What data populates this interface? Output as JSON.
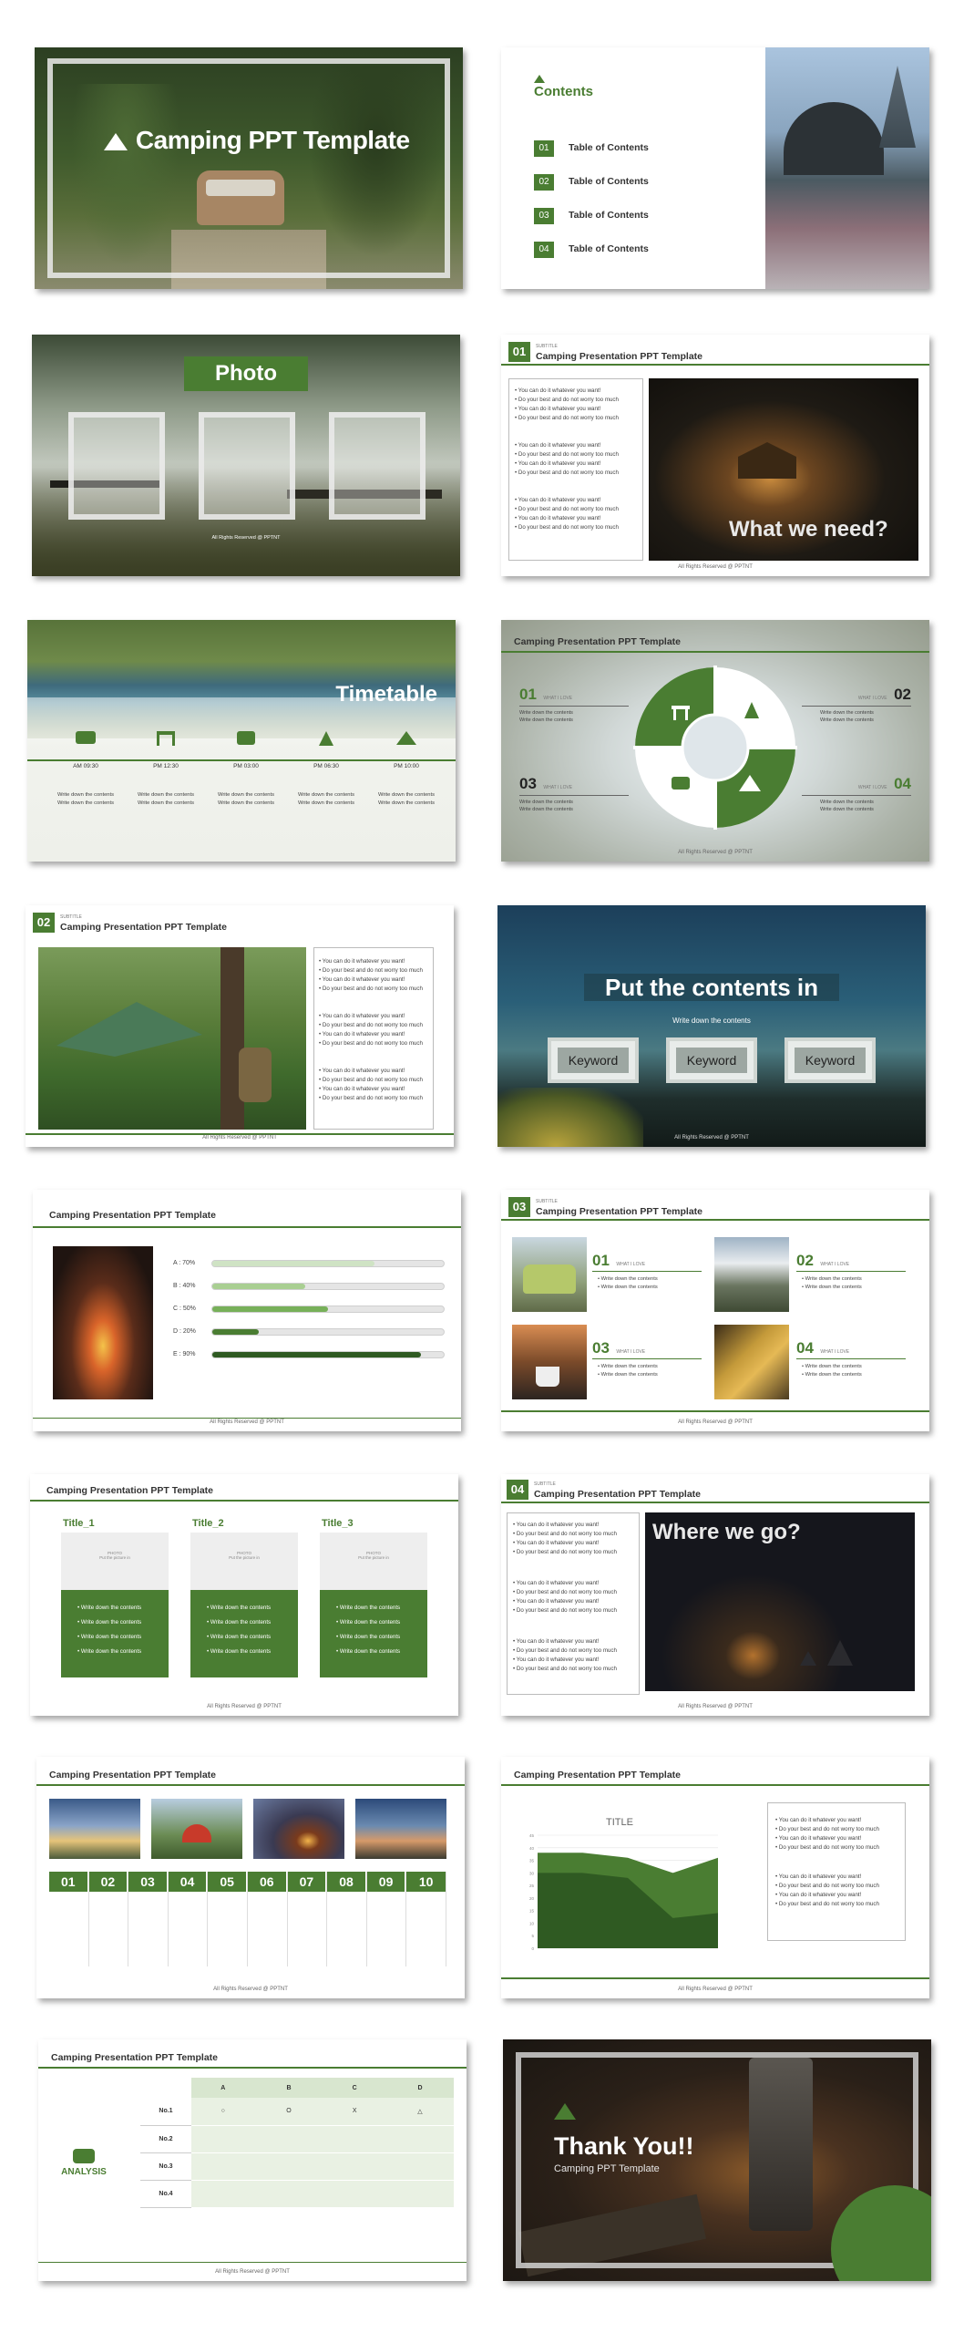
{
  "colors": {
    "accent": "#4a7d32",
    "accent_light": "#b7cfa8",
    "accent_dark": "#2f5a22"
  },
  "common": {
    "template_title": "Camping Presentation PPT Template",
    "footer": "All Rights Reserved @ PPTNT",
    "subtitle": "SUBTITLE",
    "bullets": [
      "You can do it whatever you want!",
      "Do your best and do not worry too much",
      "You can do it whatever you want!",
      "Do your best and do not worry too much"
    ],
    "write_down": "Write down the contents",
    "what_i_love": "WHAT I LOVE"
  },
  "s1": {
    "title": "Camping PPT Template"
  },
  "s2": {
    "title": "Contents",
    "items": [
      {
        "num": "01",
        "label": "Table of Contents"
      },
      {
        "num": "02",
        "label": "Table of Contents"
      },
      {
        "num": "03",
        "label": "Table of Contents"
      },
      {
        "num": "04",
        "label": "Table of Contents"
      }
    ]
  },
  "s3": {
    "title": "Photo",
    "caption": "All Rights Reserved @ PPTNT"
  },
  "s4": {
    "num": "01",
    "overlay": "What we need?"
  },
  "s5": {
    "title": "Timetable",
    "times": [
      "AM 09:30",
      "PM 12:30",
      "PM 03:00",
      "PM 06:30",
      "PM 10:00"
    ]
  },
  "s6": {
    "nums": [
      "01",
      "02",
      "03",
      "04"
    ]
  },
  "s7": {
    "num": "02"
  },
  "s8": {
    "title": "Put the contents in",
    "subtitle": "Write down the contents",
    "keywords": [
      "Keyword",
      "Keyword",
      "Keyword"
    ]
  },
  "s9": {
    "bars": [
      {
        "label": "A : 70%",
        "value": 70
      },
      {
        "label": "B : 40%",
        "value": 40
      },
      {
        "label": "C : 50%",
        "value": 50
      },
      {
        "label": "D : 20%",
        "value": 20
      },
      {
        "label": "E : 90%",
        "value": 90
      }
    ]
  },
  "s10": {
    "num": "03",
    "nums": [
      "01",
      "02",
      "03",
      "04"
    ]
  },
  "s11": {
    "columns": [
      {
        "title": "Title_1",
        "photo": "PHOTO",
        "insert": "Put the picture in"
      },
      {
        "title": "Title_2",
        "photo": "PHOTO",
        "insert": "Put the picture in"
      },
      {
        "title": "Title_3",
        "photo": "PHOTO",
        "insert": "Put the picture in"
      }
    ]
  },
  "s12": {
    "num": "04",
    "overlay": "Where we go?"
  },
  "s13": {
    "nums": [
      "01",
      "02",
      "03",
      "04",
      "05",
      "06",
      "07",
      "08",
      "09",
      "10"
    ]
  },
  "s14": {
    "chart_title": "TITLE"
  },
  "chart_data": {
    "type": "area",
    "title": "TITLE",
    "x": [
      1,
      2,
      3,
      4,
      5
    ],
    "ylim": [
      0,
      45
    ],
    "yticks": [
      0,
      5,
      10,
      15,
      20,
      25,
      30,
      35,
      40,
      45
    ],
    "series": [
      {
        "values": [
          38,
          38,
          36,
          30,
          36
        ]
      },
      {
        "values": [
          30,
          30,
          28,
          12,
          14
        ]
      }
    ]
  },
  "s15": {
    "label": "ANALYSIS",
    "headers": [
      "A",
      "B",
      "C",
      "D"
    ],
    "rows": [
      {
        "name": "No.1",
        "cells": [
          "○",
          "O",
          "X",
          "△"
        ]
      },
      {
        "name": "No.2",
        "cells": [
          "",
          "",
          "",
          ""
        ]
      },
      {
        "name": "No.3",
        "cells": [
          "",
          "",
          "",
          ""
        ]
      },
      {
        "name": "No.4",
        "cells": [
          "",
          "",
          "",
          ""
        ]
      }
    ]
  },
  "s16": {
    "title": "Thank You!!",
    "subtitle": "Camping PPT Template"
  }
}
